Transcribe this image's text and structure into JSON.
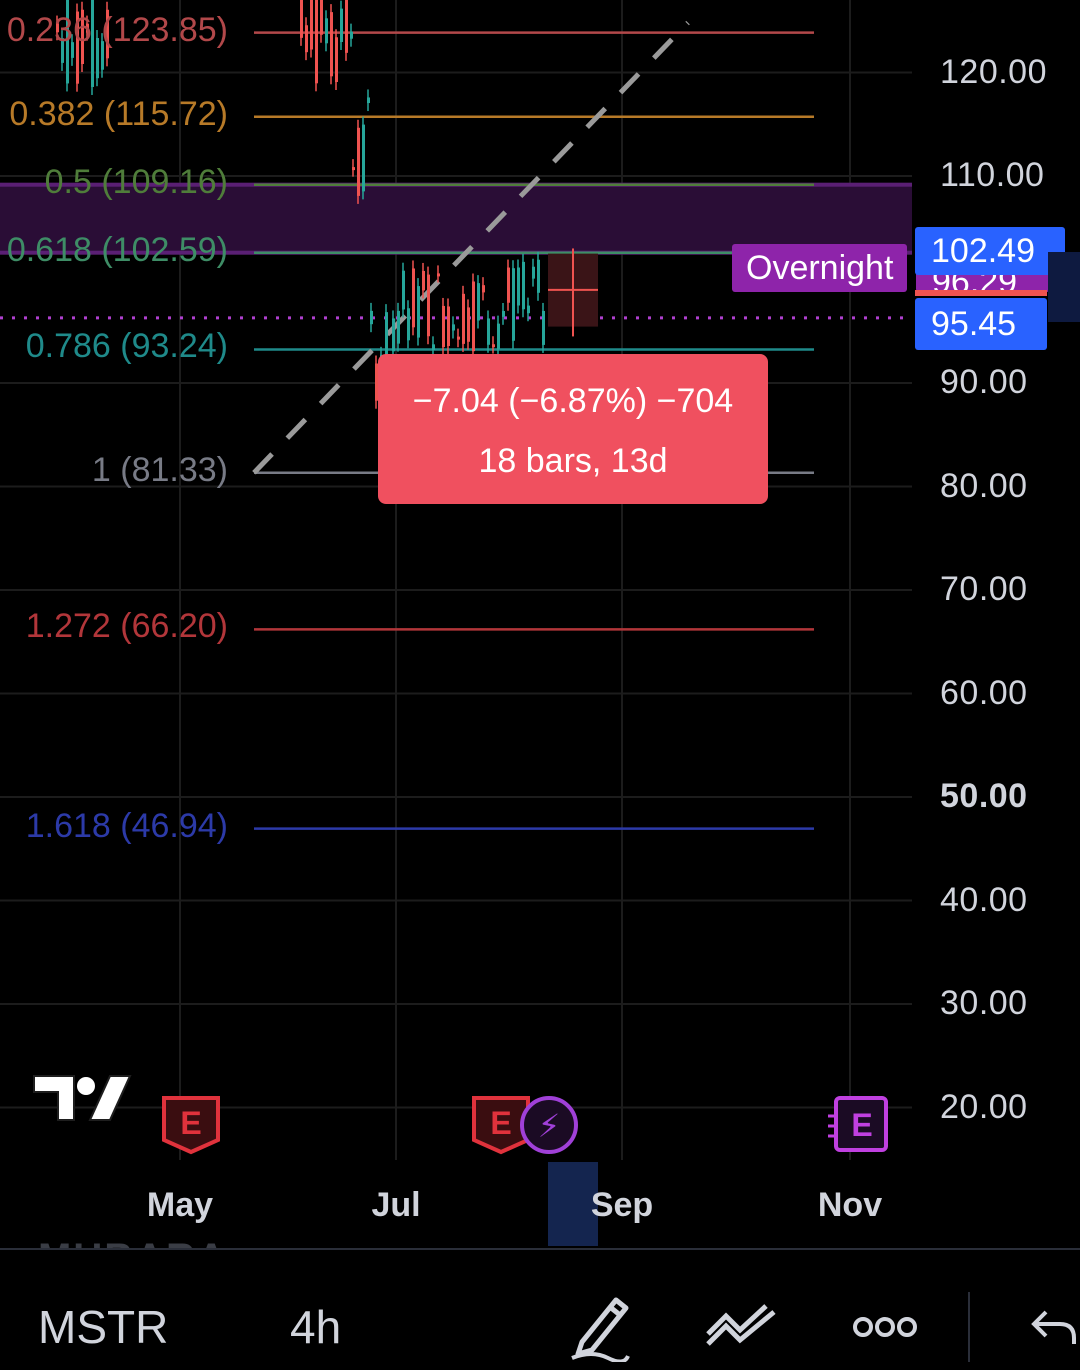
{
  "symbol": "MSTR",
  "interval": "4h",
  "ghost_text": "MUBARA",
  "price_axis": [
    "120.00",
    "110.00",
    "90.00",
    "80.00",
    "70.00",
    "60.00",
    "50.00",
    "40.00",
    "30.00",
    "20.00"
  ],
  "time_axis": [
    "May",
    "Jul",
    "Sep",
    "Nov"
  ],
  "fib_levels": [
    {
      "label": "0.236 (123.85)",
      "value": 123.85,
      "color": "#b2484a"
    },
    {
      "label": "0.382 (115.72)",
      "value": 115.72,
      "color": "#b77a28"
    },
    {
      "label": "0.5 (109.16)",
      "value": 109.16,
      "color": "#4f7d3a"
    },
    {
      "label": "0.618 (102.59)",
      "value": 102.59,
      "color": "#3e8d66"
    },
    {
      "label": "0.786 (93.24)",
      "value": 93.24,
      "color": "#1f8a8a"
    },
    {
      "label": "1 (81.33)",
      "value": 81.33,
      "color": "#787b86"
    },
    {
      "label": "1.272 (66.20)",
      "value": 66.2,
      "color": "#b2363a"
    },
    {
      "label": "1.618 (46.94)",
      "value": 46.94,
      "color": "#2c3aa8"
    }
  ],
  "price_badges": {
    "overnight_label": "Overnight",
    "last_price": "102.49",
    "hidden_price": "96.29",
    "current_price": "95.45"
  },
  "measure": {
    "line1": "−7.04 (−6.87%) −704",
    "line2": "18 bars, 13d"
  },
  "event_markers": [
    {
      "icon": "earnings-icon",
      "glyph": "E"
    },
    {
      "icon": "earnings-icon",
      "glyph": "E"
    },
    {
      "icon": "dividend-flash-icon",
      "glyph": "⚡"
    },
    {
      "icon": "earnings-upcoming-icon",
      "glyph": "E"
    }
  ],
  "logo": "TradingView",
  "colors": {
    "up": "#26a69a",
    "down": "#ef5350",
    "accent_blue": "#2962ff",
    "overnight": "#8e24aa",
    "measure": "#f0505f"
  }
}
